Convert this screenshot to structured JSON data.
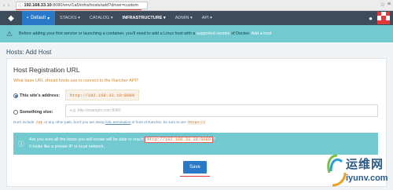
{
  "browser": {
    "url_host": "192.168.33.10",
    "url_path": ":8080/env/1a5/infra/hosts/add?driver=custom"
  },
  "nav": {
    "environment": "Default",
    "items": [
      "STACKS",
      "CATALOG",
      "INFRASTRUCTURE",
      "ADMIN",
      "API"
    ],
    "active": "INFRASTRUCTURE"
  },
  "banner": {
    "text_before": "Before adding your first service or launching a container, you'll need to add a Linux host with a ",
    "link1": "supported version",
    "text_mid": " of Docker. ",
    "link2": "Add a host"
  },
  "page": {
    "title": "Hosts: Add Host"
  },
  "form": {
    "heading": "Host Registration URL",
    "question": "What base URL should hosts use to connect to the Rancher API?",
    "option_this_site": "This site's address:",
    "this_site_value": "http://192.168.33.10:8080",
    "option_else": "Something else:",
    "else_placeholder": "e.g. http://example.com:8080",
    "help_before": "Don't include ",
    "help_code1": "/v1",
    "help_mid": " or any other path, but if you are doing ",
    "help_link": "SSL termination",
    "help_after": " in front of Rancher, be sure to use ",
    "help_code2": "https://",
    "alert_line1_before": "Are you sure all the hosts you will create will be able to reach ",
    "alert_url": "http://192.168.33.10:8080",
    "alert_line1_after": "?",
    "alert_line2": "It looks like a private IP or local network.",
    "save_label": "Save"
  },
  "watermark": {
    "cn": "运维网",
    "url": "iyunv.com"
  },
  "colors": {
    "nav_bg": "#3d4b5b",
    "accent_blue": "#2a79c9",
    "banner_teal": "#72c9cf",
    "code_orange": "#d0701f",
    "highlight_red": "#e23a3a"
  }
}
